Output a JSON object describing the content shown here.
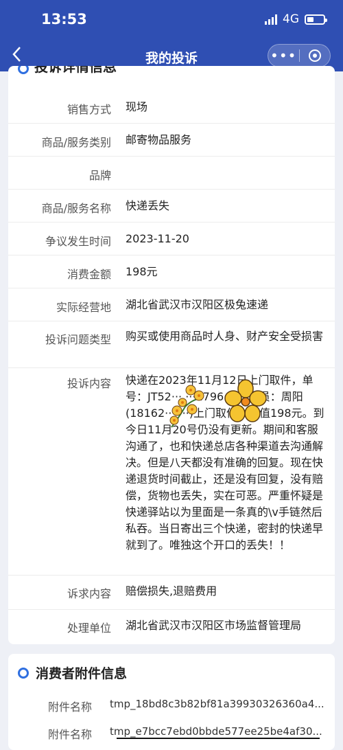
{
  "status_bar": {
    "time": "13:53",
    "network": "4G"
  },
  "navbar": {
    "back_icon": "chevron-left-icon",
    "title": "我的投诉"
  },
  "card1": {
    "section_title": "投诉详情信息",
    "rows": [
      {
        "label": "销售方式",
        "value": "现场"
      },
      {
        "label": "商品/服务类别",
        "value": "邮寄物品服务"
      },
      {
        "label": "品牌",
        "value": ""
      },
      {
        "label": "商品/服务名称",
        "value": "快递丢失"
      },
      {
        "label": "争议发生时间",
        "value": "2023-11-20"
      },
      {
        "label": "消费金额",
        "value": "198元"
      },
      {
        "label": "实际经营地",
        "value": "湖北省武汉市汉阳区极兔速递"
      },
      {
        "label": "投诉问题类型",
        "value": "购买或使用商品时人身、财产安全受损害"
      },
      {
        "label": "投诉内容",
        "value": "快递在2023年11月12日上门取件，单号：JT52··· ···1796··· ···递员：周阳(18162··· ···)上门取件，价值198元。到今日11月20号仍没有更新。期间和客服沟通了，也和快递总店各种渠道去沟通解决。但是八天都没有准确的回复。现在快递退货时间截止，还是没有回复，没有赔偿，货物也丢失，实在可恶。严重怀疑是快递驿站以为里面是一条真的\\v手链然后私吞。当日寄出三个快递，密封的快递早就到了。唯独这个开口的丢失！！"
      },
      {
        "label": "诉求内容",
        "value": "赔偿损失,退赔费用"
      },
      {
        "label": "处理单位",
        "value": "湖北省武汉市汉阳区市场监督管理局"
      }
    ]
  },
  "card2": {
    "section_title": "消费者附件信息",
    "attachments": [
      {
        "label": "附件名称",
        "value": "tmp_18bd8c3b82bf81a39930326360a4..."
      },
      {
        "label": "附件名称",
        "value": "tmp_e7bcc7ebd0bbde577ee25be4af30..."
      }
    ]
  },
  "colors": {
    "header": "#2f4fb3",
    "accent": "#2f6fe0",
    "background": "#eef0f6"
  }
}
